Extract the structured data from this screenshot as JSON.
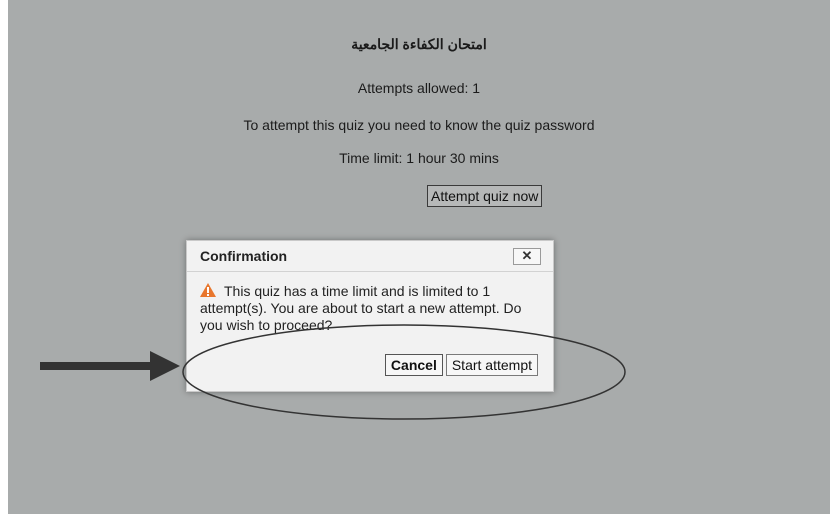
{
  "quiz": {
    "title": "امتحان الكفاءة الجامعية",
    "attempts_allowed": "Attempts allowed: 1",
    "password_notice": "To attempt this quiz you need to know the quiz password",
    "time_limit": "Time limit: 1 hour 30 mins",
    "attempt_button": "Attempt quiz now"
  },
  "dialog": {
    "title": "Confirmation",
    "close_label": "✕",
    "message": "This quiz has a time limit and is limited to 1 attempt(s). You are about to start a new attempt. Do you wish to proceed?",
    "icon": "warning-icon",
    "cancel_label": "Cancel",
    "start_label": "Start attempt"
  },
  "colors": {
    "backdrop": "#a8abab",
    "dialog_bg": "#f2f2f2",
    "warning": "#e8762d",
    "annotation": "#333333"
  }
}
